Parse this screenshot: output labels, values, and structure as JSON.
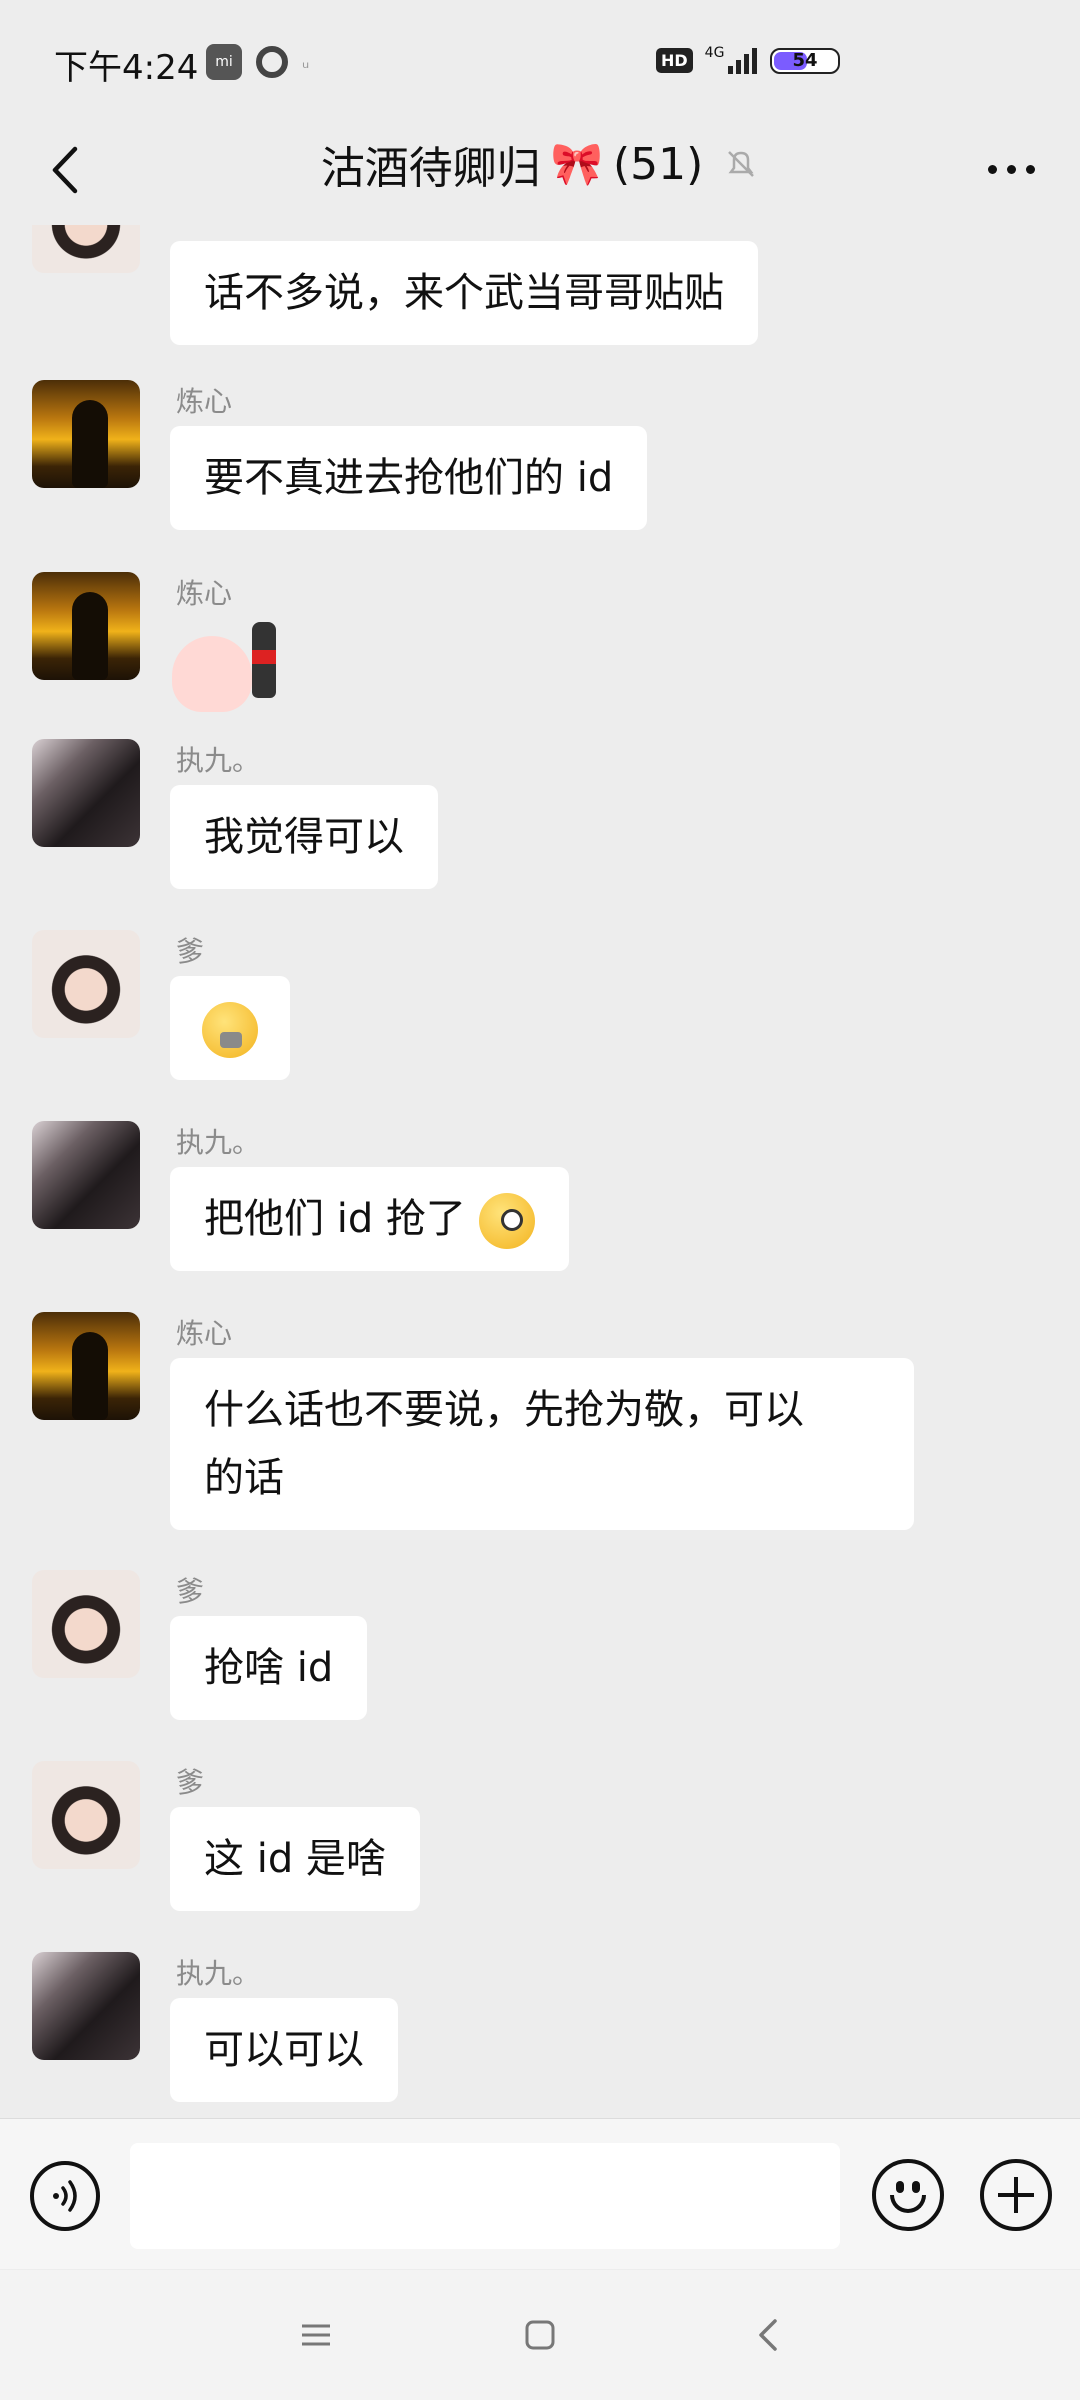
{
  "status_bar": {
    "time": "下午4:24",
    "mi_label": "mi",
    "hd": "HD",
    "network": "4G",
    "battery": "54",
    "battery_level": 0.54
  },
  "header": {
    "title": "沽酒待卿归",
    "member_count": "(51)",
    "muted": true
  },
  "messages": [
    {
      "sender": "",
      "text": "话不多说，来个武当哥哥贴贴",
      "avatar": "girl"
    },
    {
      "sender": "炼心",
      "text": "要不真进去抢他们的 id",
      "avatar": "sunset"
    },
    {
      "sender": "炼心",
      "text": "",
      "sticker": "pig-with-cola",
      "avatar": "sunset"
    },
    {
      "sender": "执九。",
      "text": "我觉得可以",
      "avatar": "dark"
    },
    {
      "sender": "爹",
      "text": "",
      "emoji": "zipper-mouth-emoji",
      "avatar": "girl"
    },
    {
      "sender": "执九。",
      "text": "把他们 id 抢了",
      "emoji": "wink-emoji",
      "avatar": "dark"
    },
    {
      "sender": "炼心",
      "text_line1": "什么话也不要说，先抢为敬，可以",
      "text_line2": "的话",
      "avatar": "sunset"
    },
    {
      "sender": "爹",
      "text": "抢啥 id",
      "avatar": "girl"
    },
    {
      "sender": "爹",
      "text": "这 id 是啥",
      "avatar": "girl"
    },
    {
      "sender": "执九。",
      "text": "可以可以",
      "avatar": "dark"
    }
  ],
  "input": {
    "placeholder": ""
  },
  "icons": {
    "back": "chevron-left-icon",
    "muted": "bell-off-icon",
    "more": "more-dots-icon",
    "voice": "voice-icon",
    "emoji": "emoji-icon",
    "plus": "plus-icon",
    "nav_menu": "menu-icon",
    "nav_home": "home-square-icon",
    "nav_back": "back-triangle-icon"
  }
}
